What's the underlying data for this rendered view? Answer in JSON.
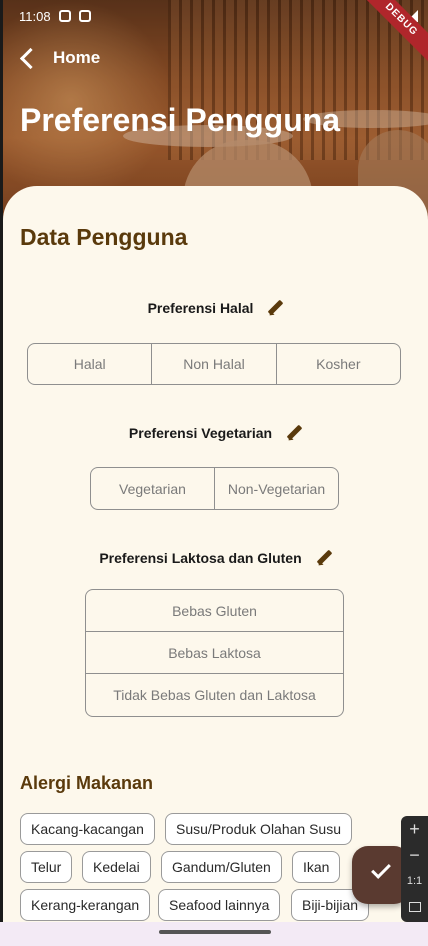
{
  "status_bar": {
    "time": "11:08",
    "debug_label": "DEBUG"
  },
  "nav": {
    "back_label": "Home"
  },
  "header": {
    "title": "Preferensi Pengguna"
  },
  "card": {
    "title": "Data Pengguna",
    "halal": {
      "label": "Preferensi Halal",
      "options": [
        "Halal",
        "Non Halal",
        "Kosher"
      ]
    },
    "vegetarian": {
      "label": "Preferensi Vegetarian",
      "options": [
        "Vegetarian",
        "Non-Vegetarian"
      ]
    },
    "lactose_gluten": {
      "label": "Preferensi Laktosa dan Gluten",
      "options": [
        "Bebas Gluten",
        "Bebas Laktosa",
        "Tidak Bebas Gluten dan Laktosa"
      ]
    },
    "allergy": {
      "title": "Alergi Makanan",
      "chips": [
        "Kacang-kacangan",
        "Susu/Produk Olahan Susu",
        "Telur",
        "Kedelai",
        "Gandum/Gluten",
        "Ikan",
        "Kerang-kerangan",
        "Seafood lainnya",
        "Biji-bijian"
      ]
    }
  },
  "zoom_controls": {
    "plus": "+",
    "minus": "−",
    "ratio": "1:1"
  },
  "colors": {
    "accent_brown": "#5a3a0c",
    "background": "#fdf8ec",
    "fab": "#5a3a30"
  }
}
